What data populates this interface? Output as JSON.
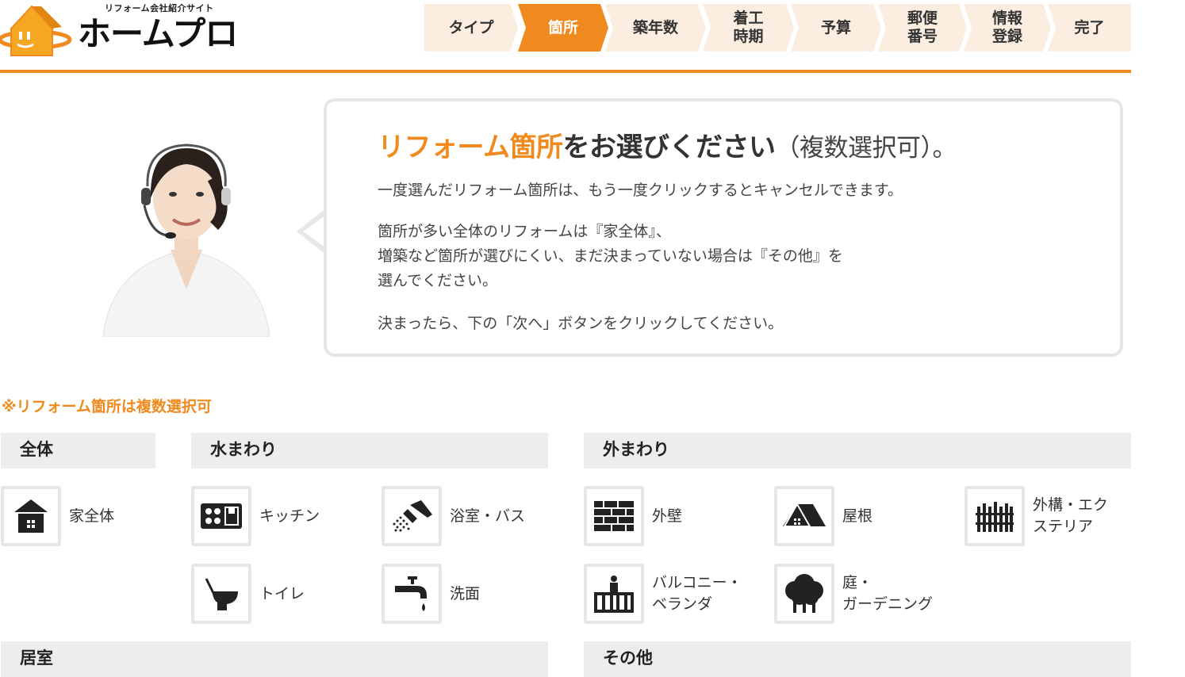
{
  "logo": {
    "tagline": "リフォーム会社紹介サイト",
    "name": "ホームプロ"
  },
  "steps": [
    {
      "label": "タイプ",
      "active": false
    },
    {
      "label": "箇所",
      "active": true
    },
    {
      "label": "築年数",
      "active": false
    },
    {
      "label": "着工\n時期",
      "active": false
    },
    {
      "label": "予算",
      "active": false
    },
    {
      "label": "郵便\n番号",
      "active": false
    },
    {
      "label": "情報\n登録",
      "active": false
    },
    {
      "label": "完了",
      "active": false
    }
  ],
  "intro": {
    "title_highlight": "リフォーム箇所",
    "title_rest": "をお選びください",
    "title_note": "（複数選択可）。",
    "line1": "一度選んだリフォーム箇所は、もう一度クリックするとキャンセルできます。",
    "line2a": "箇所が多い全体のリフォームは『家全体』、",
    "line2b": "増築など箇所が選びにくい、まだ決まっていない場合は『その他』を",
    "line2c": "選んでください。",
    "line3": "決まったら、下の「次へ」ボタンをクリックしてください。"
  },
  "multi_note": "※リフォーム箇所は複数選択可",
  "categories": {
    "whole": "全体",
    "water": "水まわり",
    "exterior": "外まわり",
    "interior": "居室",
    "other": "その他"
  },
  "items": {
    "whole_house": "家全体",
    "kitchen": "キッチン",
    "bath": "浴室・バス",
    "toilet": "トイレ",
    "washroom": "洗面",
    "wall": "外壁",
    "roof": "屋根",
    "exterior_construction": "外構・エク\nステリア",
    "balcony": "バルコニー・\nベランダ",
    "garden": "庭・\nガーデニング"
  },
  "colors": {
    "accent": "#f08a1e",
    "step_bg": "#fbeee0",
    "category_bg": "#eeedeb",
    "border": "#e6e6e6"
  }
}
